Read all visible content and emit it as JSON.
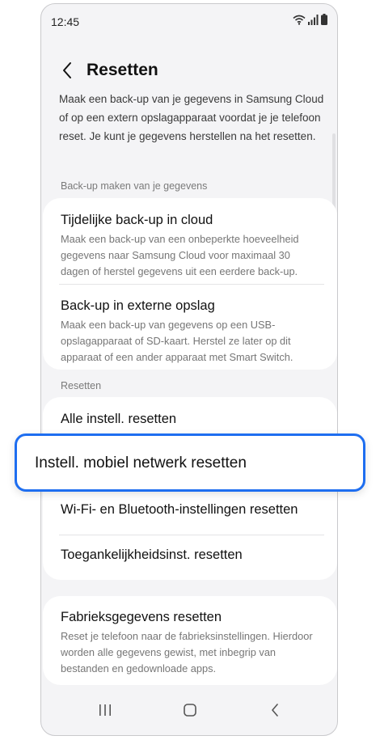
{
  "status_bar": {
    "time": "12:45",
    "icons": [
      "wifi-icon",
      "signal-icon",
      "battery-icon"
    ]
  },
  "header": {
    "back_icon": "chevron-left-icon",
    "title": "Resetten"
  },
  "intro_text": "Maak een back-up van je gegevens in Samsung Cloud of op een extern opslagapparaat voordat je je telefoon reset. Je kunt je gegevens herstellen na het resetten.",
  "backup_section": {
    "label": "Back-up maken van je gegevens",
    "items": [
      {
        "title": "Tijdelijke back-up in cloud",
        "description": "Maak een back-up van een onbeperkte hoeveelheid gegevens naar Samsung Cloud voor maximaal 30 dagen of herstel gegevens uit een eerdere back-up."
      },
      {
        "title": "Back-up in externe opslag",
        "description": "Maak een back-up van gegevens op een USB-opslagapparaat of SD-kaart. Herstel ze later op dit apparaat of een ander apparaat met Smart Switch."
      }
    ]
  },
  "reset_section": {
    "label": "Resetten",
    "items": [
      {
        "title": "Alle instell. resetten"
      },
      {
        "title": "Instell. mobiel netwerk resetten"
      },
      {
        "title": "Wi-Fi- en Bluetooth-instellingen resetten"
      },
      {
        "title": "Toegankelijkheidsinst. resetten"
      }
    ]
  },
  "factory_reset": {
    "title": "Fabrieksgegevens resetten",
    "description": "Reset je telefoon naar de fabrieksinstellingen. Hierdoor worden alle gegevens gewist, met inbegrip van bestanden en gedownloade apps."
  },
  "nav_bar": {
    "icons": [
      "recent-apps-icon",
      "home-icon",
      "back-icon"
    ]
  },
  "colors": {
    "highlight_border": "#1e6ef0",
    "background": "#f4f4f6",
    "card": "#ffffff"
  }
}
